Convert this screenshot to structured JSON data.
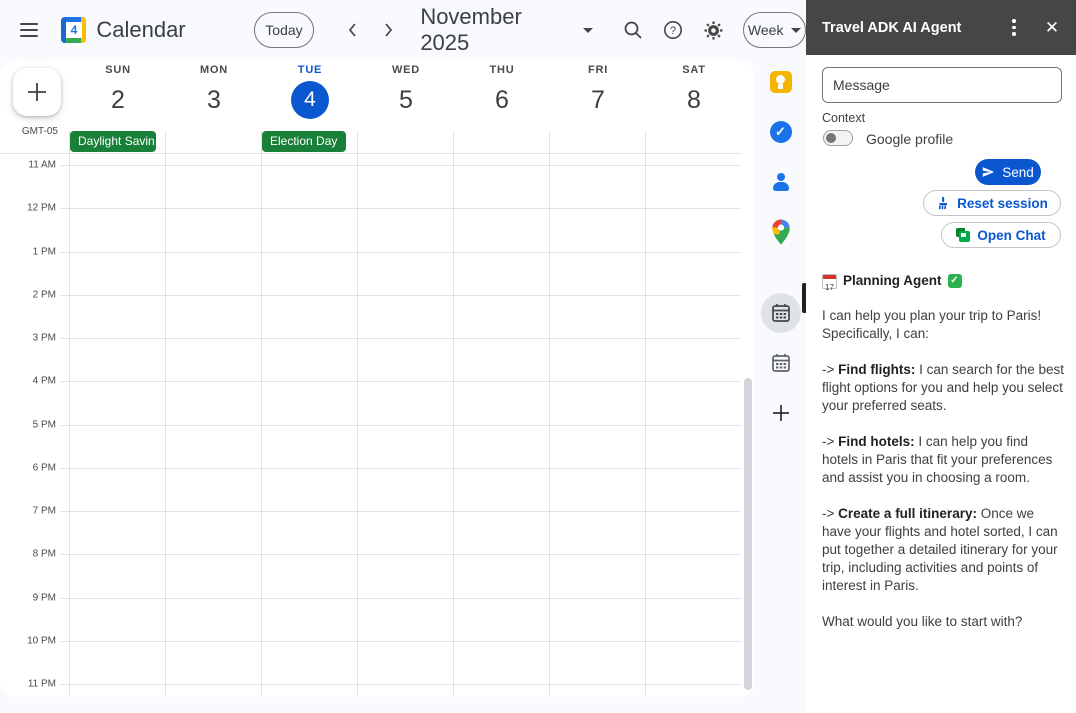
{
  "header": {
    "app_title": "Calendar",
    "logo_day": "4",
    "today_button": "Today",
    "date_range": "November 2025",
    "view_selector": "Week"
  },
  "calendar": {
    "timezone": "GMT-05",
    "days": [
      {
        "dow": "SUN",
        "date": "2"
      },
      {
        "dow": "MON",
        "date": "3"
      },
      {
        "dow": "TUE",
        "date": "4"
      },
      {
        "dow": "WED",
        "date": "5"
      },
      {
        "dow": "THU",
        "date": "6"
      },
      {
        "dow": "FRI",
        "date": "7"
      },
      {
        "dow": "SAT",
        "date": "8"
      }
    ],
    "all_day_events": [
      {
        "label": "Daylight Savin"
      },
      {
        "label": "Election Day"
      }
    ],
    "hours": [
      "11 AM",
      "12 PM",
      "1 PM",
      "2 PM",
      "3 PM",
      "4 PM",
      "5 PM",
      "6 PM",
      "7 PM",
      "8 PM",
      "9 PM",
      "10 PM",
      "11 PM"
    ]
  },
  "panel": {
    "title": "Travel ADK AI Agent",
    "message_placeholder": "Message",
    "context_label": "Context",
    "context_toggle_label": "Google profile",
    "send_label": "Send",
    "reset_label": "Reset session",
    "open_chat_label": "Open Chat",
    "chat": {
      "agent_title": "Planning Agent",
      "agent_emoji_day": "17",
      "check_glyph": "✓",
      "intro": "I can help you plan your trip to Paris! Specifically, I can:",
      "bullets": [
        {
          "arrow": "->",
          "bold": "Find flights:",
          "rest": " I can search for the best flight options for you and help you select your preferred seats."
        },
        {
          "arrow": "->",
          "bold": "Find hotels:",
          "rest": " I can help you find hotels in Paris that fit your preferences and assist you in choosing a room."
        },
        {
          "arrow": "->",
          "bold": "Create a full itinerary:",
          "rest": " Once we have your flights and hotel sorted, I can put together a detailed itinerary for your trip, including activities and points of interest in Paris."
        }
      ],
      "outro": "What would you like to start with?"
    }
  },
  "colors": {
    "accent_blue": "#0b57d0",
    "event_green": "#188038",
    "panel_header_gray": "#444746"
  }
}
